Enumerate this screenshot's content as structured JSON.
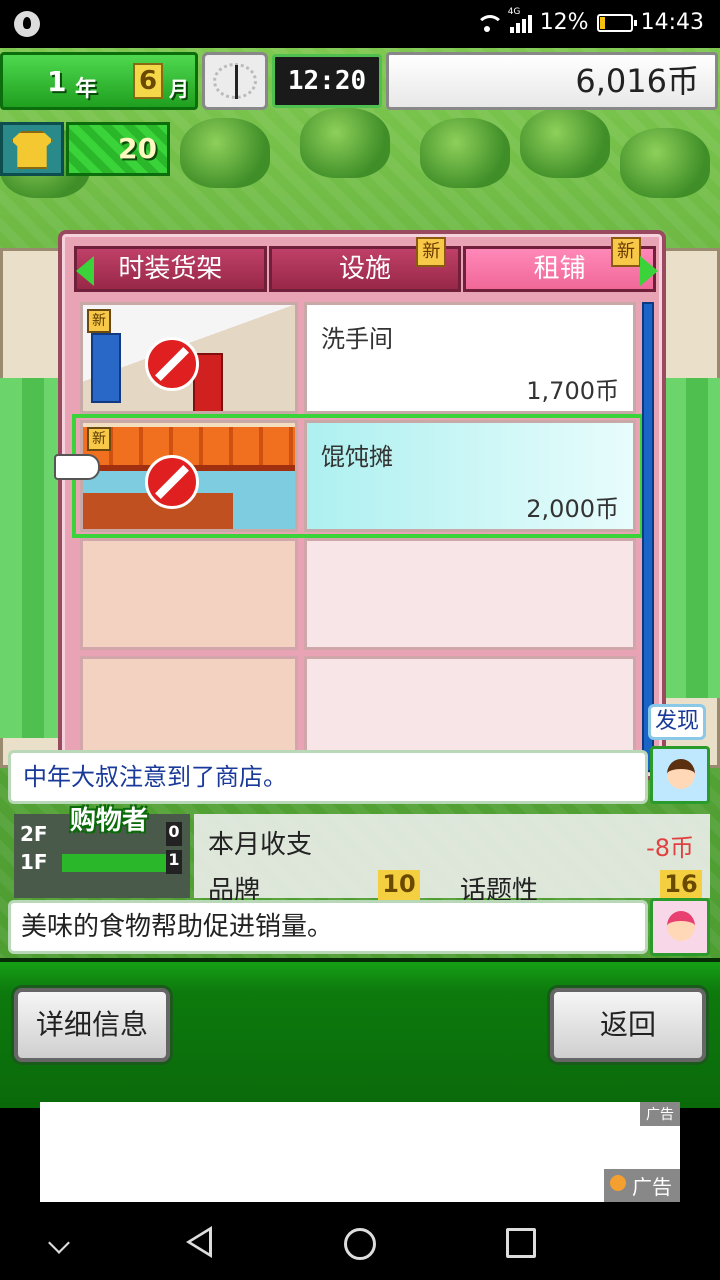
{
  "status_bar": {
    "network": "4G",
    "battery": "12%",
    "time": "14:43"
  },
  "hud": {
    "year": "1",
    "year_unit": "年",
    "month": "6",
    "month_unit": "月",
    "clock": "12:20",
    "money": "6,016币",
    "customers": "20"
  },
  "dialog": {
    "tabs": [
      {
        "label": "时装货架",
        "new": false
      },
      {
        "label": "设施",
        "new": true,
        "badge": "新"
      },
      {
        "label": "租铺",
        "new": true,
        "badge": "新",
        "active": true
      }
    ],
    "items": [
      {
        "name": "洗手间",
        "price": "1,700币",
        "new_badge": "新"
      },
      {
        "name": "馄饨摊",
        "price": "2,000币",
        "new_badge": "新",
        "selected": true
      },
      {
        "name": "",
        "price": ""
      },
      {
        "name": "",
        "price": ""
      }
    ]
  },
  "messages": {
    "notice": "中年大叔注意到了商店。",
    "discover": "发现",
    "hint": "美味的食物帮助促进销量。"
  },
  "floors": {
    "label": "购物者",
    "rows": [
      {
        "floor": "2F",
        "count": "0"
      },
      {
        "floor": "1F",
        "count": "1"
      }
    ]
  },
  "stats": {
    "monthly_label": "本月收支",
    "monthly_value": "-8币",
    "brand_label": "品牌",
    "brand_value": "10",
    "topic_label": "话题性",
    "topic_value": "16"
  },
  "buttons": {
    "detail": "详细信息",
    "back": "返回"
  },
  "ad": {
    "tag_top": "广告",
    "tag_bottom": "广告"
  },
  "colors": {
    "hud_green": "#1fa01f",
    "dialog_pink": "#e8a3b4",
    "tab_active": "#f06898",
    "select_green": "#3ad43a",
    "scrollbar_blue": "#1a64c8"
  }
}
